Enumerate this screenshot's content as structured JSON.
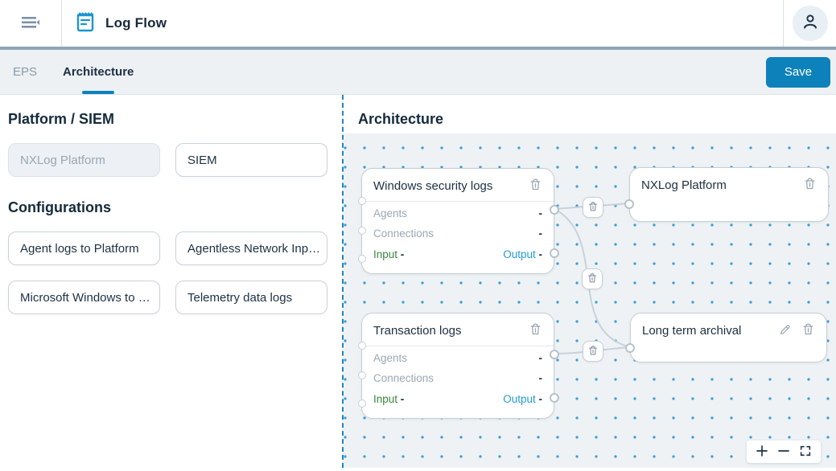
{
  "header": {
    "title": "Log Flow",
    "icons": {
      "menu": "collapse-menu-icon",
      "app": "notepad-icon",
      "user": "person-icon"
    }
  },
  "tabs": {
    "items": [
      {
        "label": "EPS",
        "active": false
      },
      {
        "label": "Architecture",
        "active": true
      }
    ],
    "save_label": "Save"
  },
  "left_panel": {
    "platform_siem_heading": "Platform / SIEM",
    "platform_chip": "NXLog Platform",
    "siem_chip": "SIEM",
    "configurations_heading": "Configurations",
    "configuration_items": [
      "Agent logs to Platform",
      "Agentless Network Inp…",
      "Microsoft Windows to …",
      "Telemetry data logs"
    ]
  },
  "canvas": {
    "heading": "Architecture",
    "nodes": [
      {
        "title": "Windows security logs",
        "rows": [
          {
            "label": "Agents",
            "value": "-"
          },
          {
            "label": "Connections",
            "value": "-"
          }
        ],
        "io": {
          "input_label": "Input",
          "input_value": "-",
          "output_label": "Output",
          "output_value": "-"
        }
      },
      {
        "title": "NXLog Platform"
      },
      {
        "title": "Transaction logs",
        "rows": [
          {
            "label": "Agents",
            "value": "-"
          },
          {
            "label": "Connections",
            "value": "-"
          }
        ],
        "io": {
          "input_label": "Input",
          "input_value": "-",
          "output_label": "Output",
          "output_value": "-"
        }
      },
      {
        "title": "Long term archival"
      }
    ],
    "edge_icons": {
      "delete": "trash-icon"
    },
    "node_icons": {
      "delete": "trash-icon",
      "edit": "pencil-icon"
    },
    "zoom_controls": {
      "zoom_in": "plus-icon",
      "zoom_out": "minus-icon",
      "fit_view": "fit-view-icon"
    }
  },
  "colors": {
    "accent_blue": "#0d82ba",
    "app_icon_blue": "#1a95d0",
    "input_green": "#3d8540",
    "output_blue": "#249bd8",
    "canvas_dot_blue": "#3f9fd6",
    "navy_text": "#15293c",
    "divider_dash_blue": "#1d85c2"
  }
}
